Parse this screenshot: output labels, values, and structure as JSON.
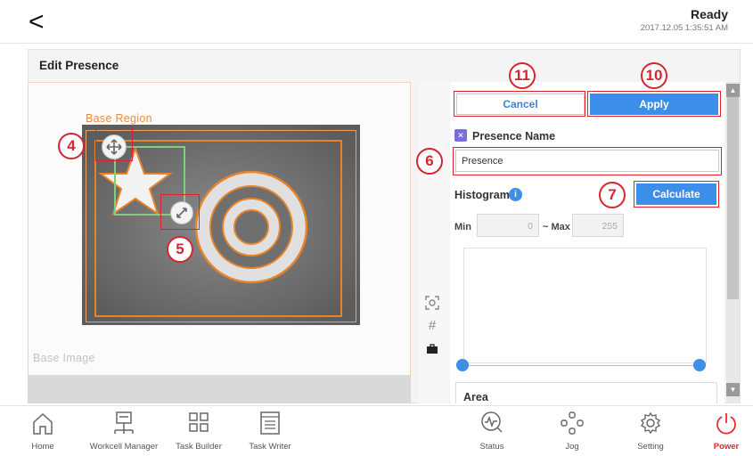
{
  "header": {
    "back_label": "<",
    "status": "Ready",
    "timestamp": "2017.12.05 1:35:51 AM"
  },
  "panel": {
    "title": "Edit Presence"
  },
  "image": {
    "region_label": "Base Region",
    "base_label": "Base Image"
  },
  "form": {
    "cancel_label": "Cancel",
    "apply_label": "Apply",
    "name_label": "Presence Name",
    "name_value": "Presence",
    "histogram_label": "Histogram",
    "calculate_label": "Calculate",
    "min_label": "Min",
    "min_value": "0",
    "max_label": "~ Max",
    "max_value": "255",
    "area_label": "Area"
  },
  "callouts": {
    "c4": "4",
    "c5": "5",
    "c6": "6",
    "c7": "7",
    "c10": "10",
    "c11": "11"
  },
  "nav": {
    "home": "Home",
    "workcell": "Workcell Manager",
    "taskbuilder": "Task Builder",
    "taskwriter": "Task Writer",
    "status": "Status",
    "jog": "Jog",
    "setting": "Setting",
    "power": "Power"
  },
  "colors": {
    "accent": "#3d8ee8",
    "callout": "#d62430",
    "region": "#e8832a",
    "power": "#e8232a"
  }
}
